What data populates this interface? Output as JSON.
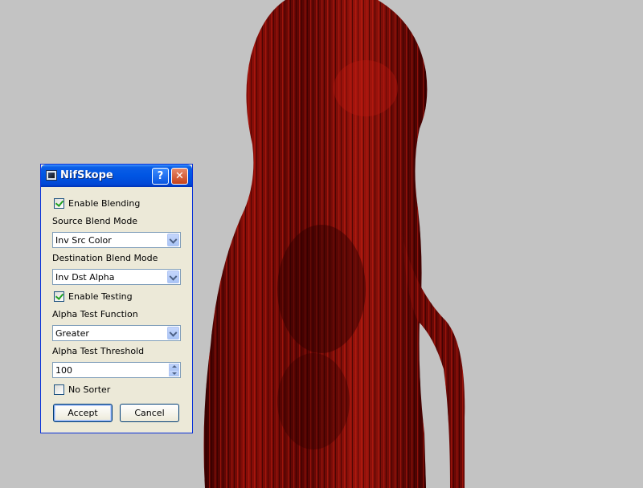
{
  "window": {
    "title": "NifSkope"
  },
  "titlebar": {
    "help_glyph": "?",
    "close_glyph": "✕"
  },
  "blending": {
    "enable_label": "Enable Blending",
    "enable_checked": true
  },
  "source_blend": {
    "label": "Source Blend Mode",
    "value": "Inv Src Color"
  },
  "destination_blend": {
    "label": "Destination Blend Mode",
    "value": "Inv Dst Alpha"
  },
  "testing": {
    "enable_label": "Enable Testing",
    "enable_checked": true
  },
  "alpha_function": {
    "label": "Alpha Test Function",
    "value": "Greater"
  },
  "alpha_threshold": {
    "label": "Alpha Test Threshold",
    "value": "100"
  },
  "sorter": {
    "label": "No Sorter",
    "checked": false
  },
  "buttons": {
    "accept": "Accept",
    "cancel": "Cancel"
  },
  "colors": {
    "viewport_bg": "#c3c3c3",
    "hair_dark": "#3a0000",
    "hair_mid": "#7a0a06",
    "hair_light": "#c41f12",
    "dialog_bg": "#ece9d8",
    "titlebar": "#0055e3"
  }
}
